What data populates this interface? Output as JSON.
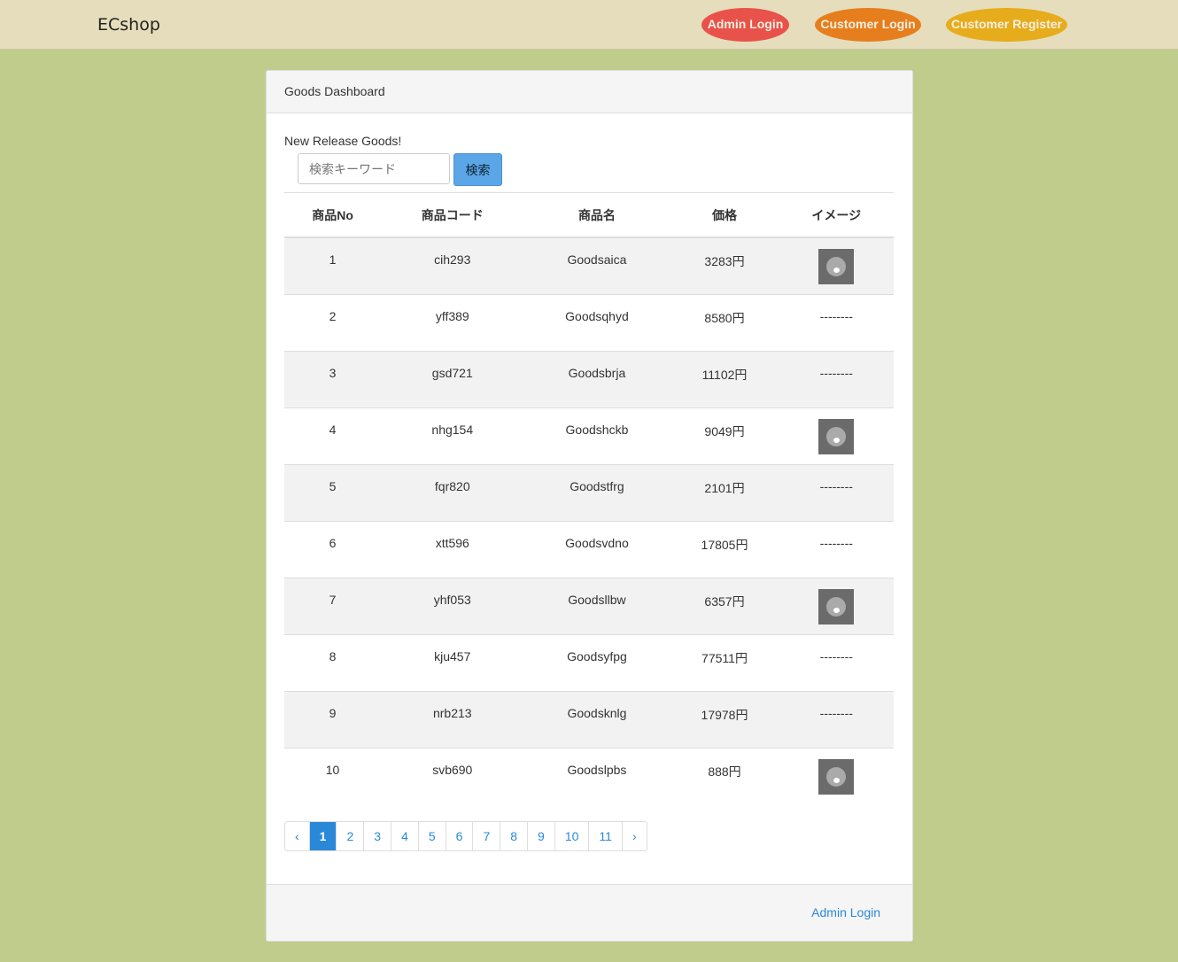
{
  "nav": {
    "brand": "ECshop",
    "admin_login": "Admin Login",
    "customer_login": "Customer Login",
    "customer_register": "Customer Register",
    "colors": {
      "admin": "#e8524a",
      "customer_login": "#e67e1e",
      "register": "#e6ac1c"
    }
  },
  "panel": {
    "title": "Goods Dashboard",
    "label": "New Release Goods!",
    "search_placeholder": "検索キーワード",
    "search_button": "検索",
    "footer_link": "Admin Login"
  },
  "table": {
    "headers": [
      "商品No",
      "商品コード",
      "商品名",
      "価格",
      "イメージ"
    ],
    "rows": [
      [
        "1",
        "cih293",
        "Goodsaica",
        "3283円",
        "img"
      ],
      [
        "2",
        "yff389",
        "Goodsqhyd",
        "8580円",
        "--------"
      ],
      [
        "3",
        "gsd721",
        "Goodsbrja",
        "11102円",
        "--------"
      ],
      [
        "4",
        "nhg154",
        "Goodshckb",
        "9049円",
        "img"
      ],
      [
        "5",
        "fqr820",
        "Goodstfrg",
        "2101円",
        "--------"
      ],
      [
        "6",
        "xtt596",
        "Goodsvdno",
        "17805円",
        "--------"
      ],
      [
        "7",
        "yhf053",
        "Goodsllbw",
        "6357円",
        "img"
      ],
      [
        "8",
        "kju457",
        "Goodsyfpg",
        "77511円",
        "--------"
      ],
      [
        "9",
        "nrb213",
        "Goodsknlg",
        "17978円",
        "--------"
      ],
      [
        "10",
        "svb690",
        "Goodslpbs",
        "888円",
        "img"
      ]
    ]
  },
  "pagination": {
    "prev": "‹",
    "next": "›",
    "pages": [
      "1",
      "2",
      "3",
      "4",
      "5",
      "6",
      "7",
      "8",
      "9",
      "10",
      "11"
    ],
    "current": "1"
  }
}
